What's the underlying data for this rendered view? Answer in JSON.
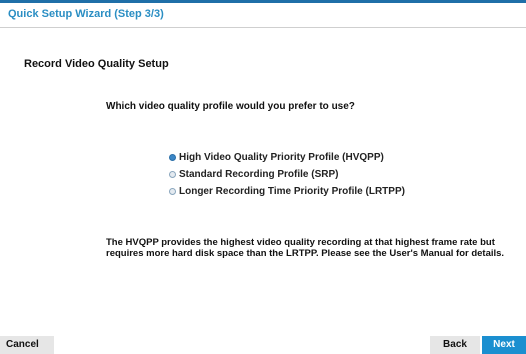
{
  "window": {
    "title": "Quick Setup Wizard (Step 3/3)"
  },
  "section": {
    "heading": "Record Video Quality Setup"
  },
  "question": "Which video quality profile would you prefer to use?",
  "options": [
    {
      "label": "High Video Quality Priority Profile (HVQPP)",
      "selected": true
    },
    {
      "label": "Standard Recording Profile (SRP)",
      "selected": false
    },
    {
      "label": "Longer Recording Time Priority Profile (LRTPP)",
      "selected": false
    }
  ],
  "description": "The HVQPP provides the highest video quality recording at that highest frame rate but requires more hard disk space than the LRTPP. Please see the User's Manual for details.",
  "buttons": {
    "cancel": "Cancel",
    "back": "Back",
    "next": "Next"
  },
  "colors": {
    "title": "#2a8ec3",
    "accent": "#1b8fd0",
    "radio_selected": "#3b86c6"
  }
}
